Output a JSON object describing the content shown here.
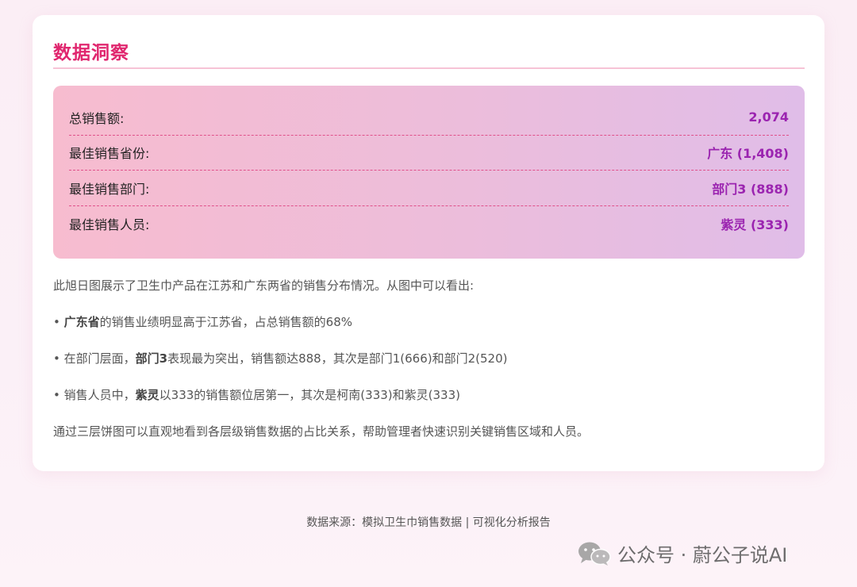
{
  "card": {
    "title": "数据洞察"
  },
  "stats": [
    {
      "label": "总销售额:",
      "value": "2,074"
    },
    {
      "label": "最佳销售省份:",
      "value": "广东 (1,408)"
    },
    {
      "label": "最佳销售部门:",
      "value": "部门3 (888)"
    },
    {
      "label": "最佳销售人员:",
      "value": "紫灵 (333)"
    }
  ],
  "description": {
    "intro": "此旭日图展示了卫生巾产品在江苏和广东两省的销售分布情况。从图中可以看出:",
    "point1": {
      "bullet": "•",
      "strong": "广东省",
      "rest": "的销售业绩明显高于江苏省，占总销售额的68%"
    },
    "point2": {
      "bullet": "•",
      "pre": "在部门层面，",
      "strong": "部门3",
      "rest": "表现最为突出，销售额达888，其次是部门1(666)和部门2(520)"
    },
    "point3": {
      "bullet": "•",
      "pre": "销售人员中，",
      "strong": "紫灵",
      "rest": "以333的销售额位居第一，其次是柯南(333)和紫灵(333)"
    },
    "conclusion": "通过三层饼图可以直观地看到各层级销售数据的占比关系，帮助管理者快速识别关键销售区域和人员。"
  },
  "footer": {
    "text": "数据来源：模拟卫生巾销售数据 | 可视化分析报告"
  },
  "watermark": {
    "icon": "wechat-icon",
    "text": "公众号 · 蔚公子说AI"
  }
}
